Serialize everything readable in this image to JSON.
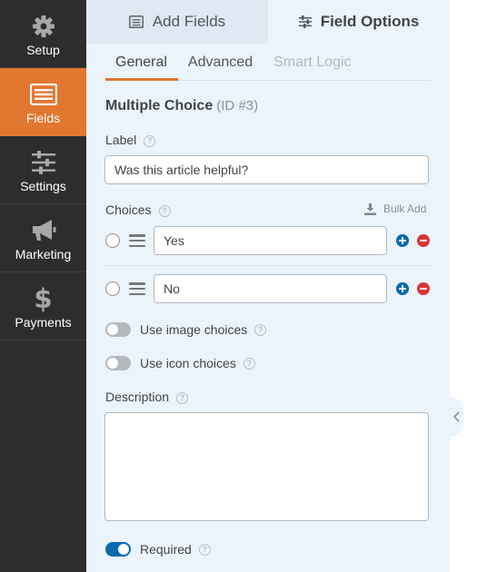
{
  "nav": {
    "items": [
      {
        "label": "Setup",
        "icon": "gear-icon"
      },
      {
        "label": "Fields",
        "icon": "fields-list-icon",
        "active": true
      },
      {
        "label": "Settings",
        "icon": "sliders-icon"
      },
      {
        "label": "Marketing",
        "icon": "megaphone-icon"
      },
      {
        "label": "Payments",
        "icon": "dollar-icon",
        "glyph": "$"
      }
    ]
  },
  "panel": {
    "tabs": {
      "add_fields": "Add Fields",
      "field_options": "Field Options"
    },
    "subtabs": {
      "general": "General",
      "advanced": "Advanced",
      "smart_logic": "Smart Logic"
    },
    "field": {
      "title": "Multiple Choice",
      "id_text": "(ID #3)"
    },
    "label_section": {
      "label": "Label",
      "value": "Was this article helpful?"
    },
    "choices_section": {
      "label": "Choices",
      "bulk_add": "Bulk Add",
      "choices": [
        {
          "value": "Yes"
        },
        {
          "value": "No"
        }
      ]
    },
    "toggles": {
      "image_choices": "Use image choices",
      "icon_choices": "Use icon choices",
      "required": "Required",
      "required_on": true
    },
    "description_section": {
      "label": "Description",
      "value": ""
    },
    "help_glyph": "?"
  },
  "colors": {
    "nav_bg": "#2d2d2d",
    "nav_active": "#e27730",
    "panel_bg": "#ebf3fb",
    "add_btn": "#036aab",
    "remove_btn": "#d63638",
    "toggle_on": "#056aab"
  }
}
